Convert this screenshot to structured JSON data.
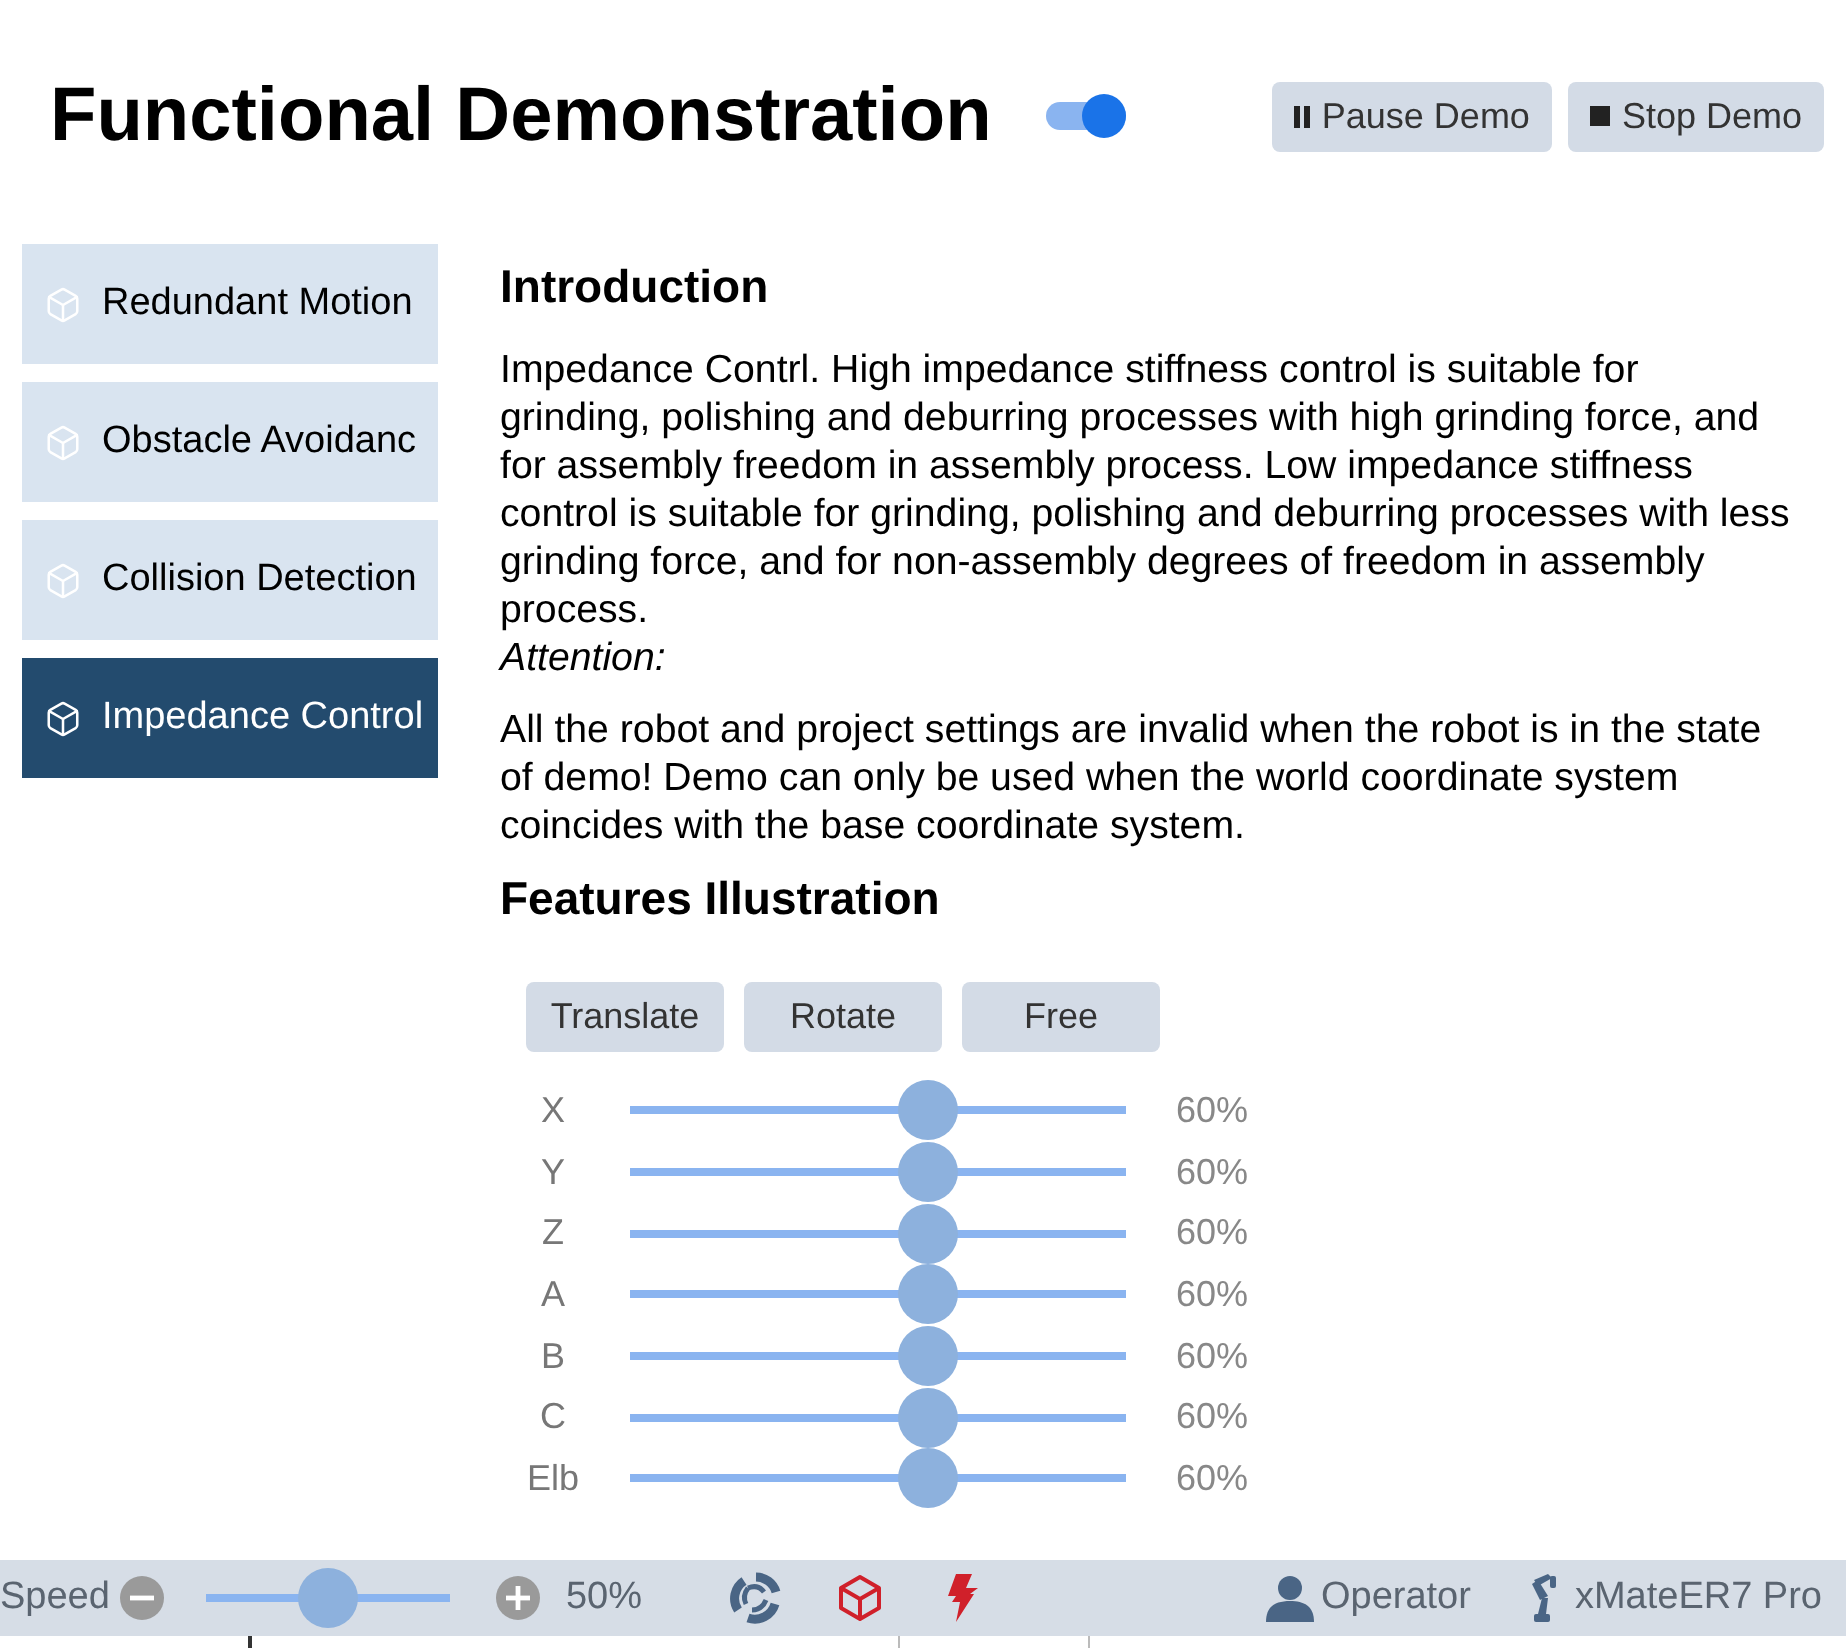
{
  "header": {
    "title": "Functional Demonstration",
    "demo_toggle": {
      "on": true
    },
    "buttons": [
      {
        "kind": "pause",
        "label": "Pause Demo"
      },
      {
        "kind": "stop",
        "label": "Stop Demo"
      }
    ]
  },
  "sidebar": {
    "items": [
      {
        "label": "Redundant Motion",
        "selected": false
      },
      {
        "label": "Obstacle Avoidanc",
        "selected": false
      },
      {
        "label": "Collision Detection",
        "selected": false
      },
      {
        "label": "Impedance Control",
        "selected": true
      }
    ]
  },
  "content": {
    "introduction": {
      "heading": "Introduction",
      "paragraph": "Impedance Contrl. High impedance stiffness control is suitable for grinding, polishing and deburring processes with high grinding force, and for assembly freedom in assembly process. Low impedance stiffness control is suitable for grinding, polishing and deburring processes with less grinding force, and for non-assembly degrees of freedom in assembly process.",
      "attention_label": "Attention:",
      "attention_text": "All the robot and project settings are invalid when the robot is in the state of demo! Demo can only be used when the world coordinate system coincides with the base coordinate system."
    },
    "features": {
      "heading": "Features Illustration",
      "modes": [
        {
          "label": "Translate",
          "selected": false
        },
        {
          "label": "Rotate",
          "selected": false
        },
        {
          "label": "Free",
          "selected": false
        }
      ],
      "sliders": [
        {
          "label": "X",
          "level": 0.6,
          "reading": "60%"
        },
        {
          "label": "Y",
          "level": 0.6,
          "reading": "60%"
        },
        {
          "label": "Z",
          "level": 0.6,
          "reading": "60%"
        },
        {
          "label": "A",
          "level": 0.6,
          "reading": "60%"
        },
        {
          "label": "B",
          "level": 0.6,
          "reading": "60%"
        },
        {
          "label": "C",
          "level": 0.6,
          "reading": "60%"
        },
        {
          "label": "Elb",
          "level": 0.6,
          "reading": "60%"
        }
      ]
    }
  },
  "status_bar": {
    "speed_label": "Speed",
    "speed": {
      "level": 0.5
    },
    "speed_reading": "50%",
    "user": "Operator",
    "robot": "xMateER7 Pro"
  }
}
